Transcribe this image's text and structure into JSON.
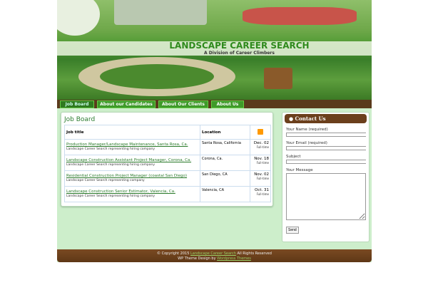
{
  "header": {
    "title": "LANDSCAPE CAREER SEARCH",
    "subtitle": "A Division of Career Climbers"
  },
  "nav": [
    {
      "label": "Job Board"
    },
    {
      "label": "About our Candidates"
    },
    {
      "label": "About Our Clients"
    },
    {
      "label": "About Us"
    }
  ],
  "main": {
    "title": "Job Board",
    "columns": [
      "Job title",
      "Location"
    ],
    "jobs": [
      {
        "title": "Production Manager/Landscape Maintenance, Santa Rosa, Ca.",
        "sub": "Landscape Career Search representing hiring company",
        "location": "Santa Rosa, California",
        "date": "Dec. 02",
        "type": "Full-time"
      },
      {
        "title": "Landscape Construction Assistant Project Manager, Corona, Ca.",
        "sub": "Landscape Career Search representing hiring company",
        "location": "Corona, Ca.",
        "date": "Nov. 18",
        "type": "Full-time"
      },
      {
        "title": "Residential Construction Project Manager (coastal San Diego)",
        "sub": "Landscape Career Search representing company",
        "location": "San Diego, CA",
        "date": "Nov. 02",
        "type": "Full-time"
      },
      {
        "title": "Landscape Construction Senior Estimator, Valencia, Ca.",
        "sub": "Landscape Career Search representing hiring company",
        "location": "Valencia, CA",
        "date": "Oct. 31",
        "type": "Full-time"
      }
    ]
  },
  "contact": {
    "title": "Contact Us",
    "name_label": "Your Name (required)",
    "email_label": "Your Email (required)",
    "subject_label": "Subject",
    "message_label": "Your Message",
    "send": "Send"
  },
  "footer": {
    "copyright": "© Copyright 2015",
    "site_link": "Landscape Career Search",
    "rights": "All Rights Reserved",
    "design": "WP Theme Design by",
    "design_link": "Wordpress Themes"
  }
}
